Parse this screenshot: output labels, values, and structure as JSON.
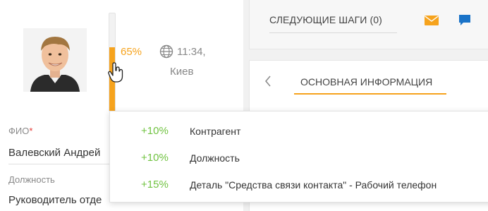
{
  "contact": {
    "completeness_percent": 65,
    "completeness_label": "65%",
    "time": "11:34,",
    "city": "Киев",
    "fields": [
      {
        "label": "ФИО",
        "required_mark": "*",
        "value": "Валевский Андрей"
      },
      {
        "label": "Должность",
        "value": "Руководитель отде"
      }
    ]
  },
  "next_steps": {
    "label": "СЛЕДУЮЩИЕ ШАГИ (0)",
    "mail_icon": "mail-icon",
    "chat_icon": "chat-icon"
  },
  "info_tab": {
    "label": "ОСНОВНАЯ ИНФОРМАЦИЯ"
  },
  "tooltip": {
    "items": [
      {
        "pct": "+10%",
        "text": "Контрагент"
      },
      {
        "pct": "+10%",
        "text": "Должность"
      },
      {
        "pct": "+15%",
        "text": "Деталь \"Средства связи контакта\" - Рабочий телефон"
      }
    ]
  },
  "colors": {
    "accent_orange": "#f6a31d",
    "positive_green": "#71c342",
    "chat_blue": "#1a73c8",
    "required_red": "#e53935"
  }
}
